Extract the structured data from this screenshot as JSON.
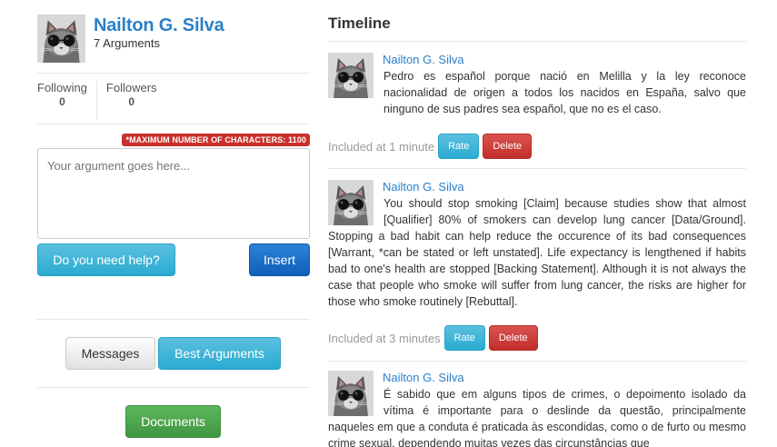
{
  "profile": {
    "name": "Nailton G. Silva",
    "arguments": "7 Arguments"
  },
  "stats": {
    "following_label": "Following",
    "following_value": "0",
    "followers_label": "Followers",
    "followers_value": "0"
  },
  "composer": {
    "max_chars_label": "*MAXIMUM NUMBER OF CHARACTERS: 1100",
    "placeholder": "Your argument goes here...",
    "help_label": "Do you need help?",
    "insert_label": "Insert"
  },
  "nav": {
    "messages_label": "Messages",
    "best_label": "Best Arguments",
    "documents_label": "Documents"
  },
  "timeline": {
    "title": "Timeline",
    "posts": [
      {
        "author": "Nailton G. Silva",
        "text": "Pedro es español porque nació en Melilla y la ley reconoce nacionalidad de origen a todos los nacidos en España, salvo que ninguno de sus padres sea español, que no es el caso.",
        "included": "Included at 1 minute",
        "rate_label": "Rate",
        "delete_label": "Delete"
      },
      {
        "author": "Nailton G. Silva",
        "text": "You should stop smoking [Claim] because studies show that almost [Qualifier] 80% of smokers can develop lung cancer [Data/Ground]. Stopping a bad habit can help reduce the occurence of its bad consequences [Warrant, *can be stated or left unstated]. Life expectancy is lengthened if habits bad to one's health are stopped [Backing Statement]. Although it is not always the case that people who smoke will suffer from lung cancer, the risks are higher for those who smoke routinely [Rebuttal].",
        "included": "Included at 3 minutes",
        "rate_label": "Rate",
        "delete_label": "Delete"
      },
      {
        "author": "Nailton G. Silva",
        "text": "É sabido que em alguns tipos de crimes, o depoimento isolado da vítima é importante para o deslinde da questão, principalmente naqueles em que a conduta é praticada às escondidas, como o de furto ou mesmo crime sexual, dependendo muitas vezes das circunstâncias que"
      }
    ]
  },
  "colors": {
    "link": "#2a7fc9",
    "info": "#31b0d5",
    "danger": "#d9534f",
    "success": "#5cb85c",
    "primary": "#1a6cc4"
  },
  "icons": {
    "avatar": "cat-with-sunglasses-icon"
  }
}
